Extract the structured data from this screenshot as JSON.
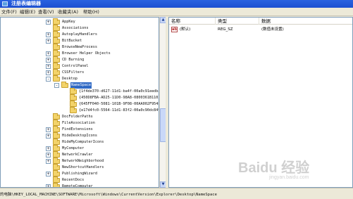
{
  "window": {
    "title": "注册表编辑器"
  },
  "menu": [
    "文件(F)",
    "编辑(E)",
    "查看(V)",
    "收藏夹(A)",
    "帮助(H)"
  ],
  "tree": {
    "items": [
      {
        "label": "AppKey",
        "level": 0,
        "expander": "+"
      },
      {
        "label": "Associations",
        "level": 0,
        "expander": ""
      },
      {
        "label": "AutoplayHandlers",
        "level": 0,
        "expander": "+"
      },
      {
        "label": "BitBucket",
        "level": 0,
        "expander": "+"
      },
      {
        "label": "BrowseNewProcess",
        "level": 0,
        "expander": ""
      },
      {
        "label": "Browser Helper Objects",
        "level": 0,
        "expander": "+"
      },
      {
        "label": "CD Burning",
        "level": 0,
        "expander": "+"
      },
      {
        "label": "ControlPanel",
        "level": 0,
        "expander": "+"
      },
      {
        "label": "CSSFilters",
        "level": 0,
        "expander": "+"
      },
      {
        "label": "Desktop",
        "level": 0,
        "expander": "-"
      },
      {
        "label": "NameSpace",
        "level": 1,
        "expander": "-",
        "selected": true
      },
      {
        "label": "{1f4de370-d627-11d1-ba4f-00a0c91eedba}",
        "level": 2,
        "expander": ""
      },
      {
        "label": "{450D8FBA-AD25-11D0-98A8-0800361B1103}",
        "level": 2,
        "expander": ""
      },
      {
        "label": "{645FF040-5081-101B-9F08-00AA002F954E}",
        "level": 2,
        "expander": ""
      },
      {
        "label": "{e17d4fc0-5564-11d1-83f2-00a0c90dc849}",
        "level": 2,
        "expander": ""
      },
      {
        "label": "DocFolderPaths",
        "level": 0,
        "expander": ""
      },
      {
        "label": "FileAssociation",
        "level": 0,
        "expander": ""
      },
      {
        "label": "FindExtensions",
        "level": 0,
        "expander": "+"
      },
      {
        "label": "HideDesktopIcons",
        "level": 0,
        "expander": "+"
      },
      {
        "label": "HideMyComputerIcons",
        "level": 0,
        "expander": ""
      },
      {
        "label": "MyComputer",
        "level": 0,
        "expander": "+"
      },
      {
        "label": "NetworkCrawler",
        "level": 0,
        "expander": "+"
      },
      {
        "label": "NetworkNeighborhood",
        "level": 0,
        "expander": "+"
      },
      {
        "label": "NewShortcutHandlers",
        "level": 0,
        "expander": ""
      },
      {
        "label": "PublishingWizard",
        "level": 0,
        "expander": "+"
      },
      {
        "label": "RecentDocs",
        "level": 0,
        "expander": ""
      },
      {
        "label": "RemoteComputer",
        "level": 0,
        "expander": "+"
      }
    ]
  },
  "list": {
    "columns": [
      "名称",
      "类型",
      "数据"
    ],
    "rows": [
      {
        "icon": "ab",
        "name": "(默认)",
        "type": "REG_SZ",
        "data": "(数值未设置)"
      }
    ]
  },
  "watermark": {
    "main": "Baidu 经验",
    "sub": "jingyan.baidu.com"
  },
  "statusbar": {
    "path": "的电脑\\HKEY_LOCAL_MACHINE\\SOFTWARE\\Microsoft\\Windows\\CurrentVersion\\Explorer\\Desktop\\NameSpace"
  }
}
